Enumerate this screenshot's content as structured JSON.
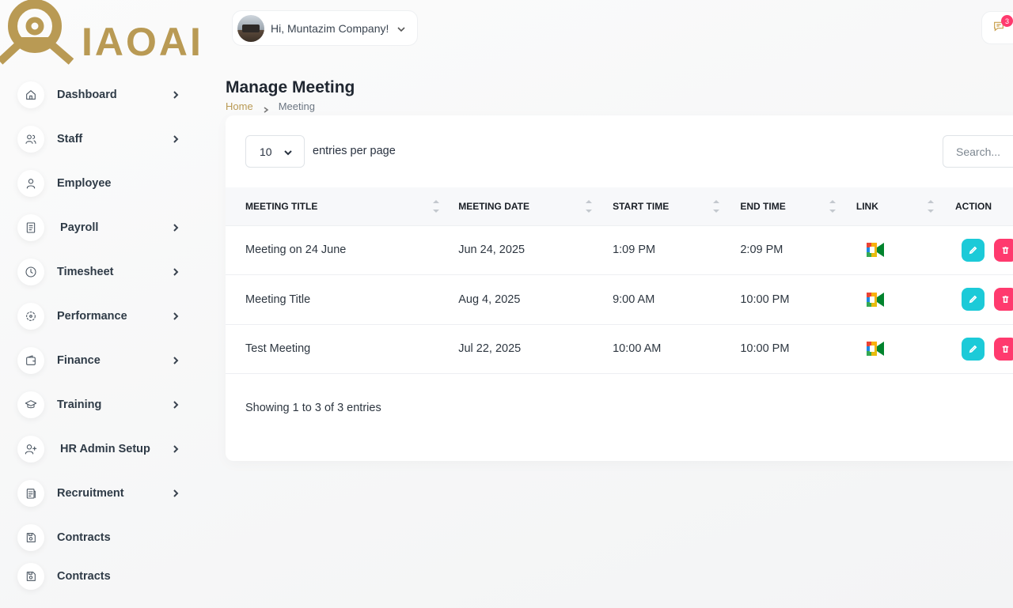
{
  "brand": {
    "logo_text": "IAOAI",
    "accent": "#b99a54"
  },
  "sidebar": {
    "items": [
      {
        "label": "Dashboard",
        "icon": "home-icon",
        "has_submenu": true
      },
      {
        "label": "Staff",
        "icon": "users-icon",
        "has_submenu": true
      },
      {
        "label": "Employee",
        "icon": "user-icon",
        "has_submenu": false
      },
      {
        "label": " Payroll",
        "icon": "receipt-icon",
        "has_submenu": true
      },
      {
        "label": "Timesheet",
        "icon": "clock-icon",
        "has_submenu": true
      },
      {
        "label": "Performance",
        "icon": "target-icon",
        "has_submenu": true
      },
      {
        "label": "Finance",
        "icon": "wallet-icon",
        "has_submenu": true
      },
      {
        "label": "Training",
        "icon": "graduation-cap-icon",
        "has_submenu": true
      },
      {
        "label": " HR Admin Setup",
        "icon": "user-plus-icon",
        "has_submenu": true
      },
      {
        "label": "Recruitment",
        "icon": "clipboard-icon",
        "has_submenu": true
      },
      {
        "label": "Contracts",
        "icon": "device-floppy-icon",
        "has_submenu": false
      },
      {
        "label": "Contracts",
        "icon": "device-floppy-icon",
        "has_submenu": false
      }
    ]
  },
  "header": {
    "user_greeting": "Hi, Muntazim Company!",
    "messages_badge": "3"
  },
  "page": {
    "title": "Manage Meeting",
    "breadcrumb": {
      "home": "Home",
      "current": "Meeting"
    }
  },
  "table_controls": {
    "per_page_value": "10",
    "per_page_label": "entries per page",
    "search_placeholder": "Search..."
  },
  "table": {
    "columns": [
      "Meeting Title",
      "Meeting Date",
      "Start Time",
      "End Time",
      "Link",
      "Action"
    ],
    "rows": [
      {
        "title": "Meeting on 24 June",
        "date": "Jun 24, 2025",
        "start": "1:09 PM",
        "end": "2:09 PM"
      },
      {
        "title": "Meeting Title",
        "date": "Aug 4, 2025",
        "start": "9:00 AM",
        "end": "10:00 PM"
      },
      {
        "title": "Test Meeting",
        "date": "Jul 22, 2025",
        "start": "10:00 AM",
        "end": "10:00 PM"
      }
    ],
    "footer": "Showing 1 to 3 of 3 entries"
  },
  "colors": {
    "edit": "#1ccad8",
    "delete": "#ff3a6e",
    "badge": "#ff3a6e"
  }
}
